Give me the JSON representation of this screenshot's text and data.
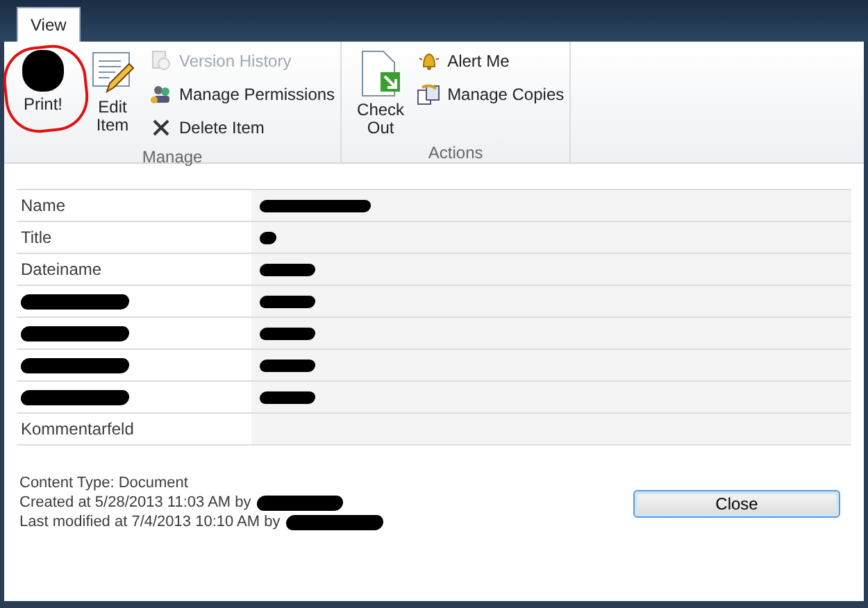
{
  "tabs": [
    {
      "label": "View",
      "selected": true
    }
  ],
  "ribbon_groups": [
    {
      "label": "Manage",
      "buttons": [
        {
          "kind": "print",
          "large": true,
          "label": "Print!",
          "icon_redacted": true,
          "annotated": true,
          "disabled": false
        },
        {
          "kind": "edit",
          "large": true,
          "label": "Edit Item",
          "disabled": false
        },
        {
          "kind": "version-history",
          "large": false,
          "label": "Version History",
          "disabled": true
        },
        {
          "kind": "permissions",
          "large": false,
          "label": "Manage Permissions",
          "disabled": false
        },
        {
          "kind": "delete",
          "large": false,
          "label": "Delete Item",
          "disabled": false
        }
      ]
    },
    {
      "label": "Actions",
      "buttons": [
        {
          "kind": "check-out",
          "large": true,
          "label": "Check Out",
          "disabled": false
        },
        {
          "kind": "alert",
          "large": false,
          "label": "Alert Me",
          "disabled": false
        },
        {
          "kind": "copies",
          "large": false,
          "label": "Manage Copies",
          "disabled": false
        }
      ]
    }
  ],
  "fields": [
    {
      "label": "Name",
      "label_redacted": false,
      "value_redacted": true
    },
    {
      "label": "Title",
      "label_redacted": false,
      "value_redacted": true
    },
    {
      "label": "Dateiname",
      "label_redacted": false,
      "value_redacted": true
    },
    {
      "label_redacted": true,
      "value_redacted": true
    },
    {
      "label_redacted": true,
      "value_redacted": true
    },
    {
      "label_redacted": true,
      "value_redacted": true
    },
    {
      "label_redacted": true,
      "value_redacted": true
    },
    {
      "label": "Kommentarfeld",
      "label_redacted": false,
      "value_redacted": false
    }
  ],
  "footer": [
    {
      "text": "Content Type: Document",
      "name_redacted": false
    },
    {
      "text": "Created at 5/28/2013 11:03 AM by",
      "name_redacted": true
    },
    {
      "text": "Last modified at 7/4/2013 10:10 AM by",
      "name_redacted": true
    }
  ],
  "close_button": {
    "label": "Close"
  }
}
